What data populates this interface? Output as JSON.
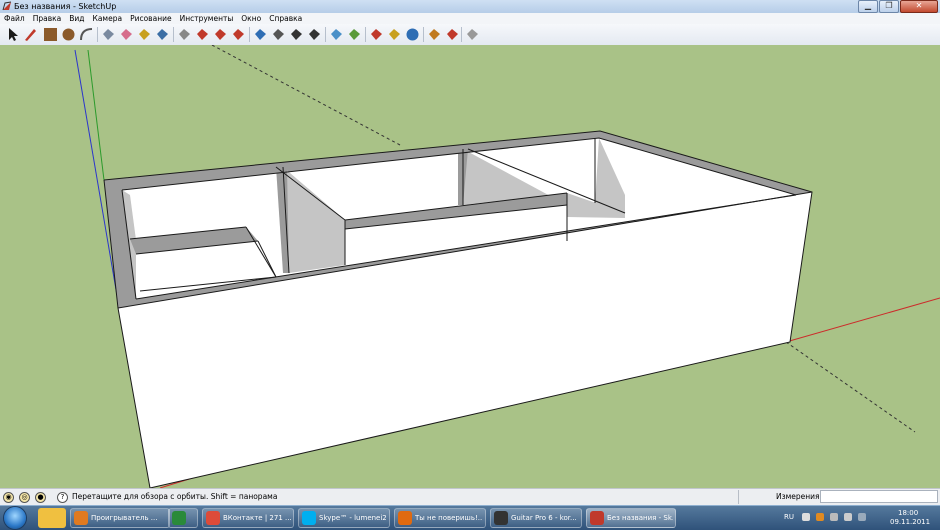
{
  "window": {
    "title": "Без названия - SketchUp",
    "minimize_glyph": "▁",
    "maximize_glyph": "❐",
    "close_glyph": "✕"
  },
  "menu": [
    "Файл",
    "Правка",
    "Вид",
    "Камера",
    "Рисование",
    "Инструменты",
    "Окно",
    "Справка"
  ],
  "toolbar": {
    "tools": [
      {
        "name": "select-icon",
        "color": "#1a1a1a"
      },
      {
        "name": "pencil-icon",
        "color": "#c0392b"
      },
      {
        "name": "rectangle-icon",
        "color": "#8b5a2b"
      },
      {
        "name": "circle-icon",
        "color": "#8b5a2b"
      },
      {
        "name": "arc-icon",
        "color": "#555555"
      },
      {
        "name": "make-component-icon",
        "color": "#7a8aa0"
      },
      {
        "name": "eraser-icon",
        "color": "#d66d8c"
      },
      {
        "name": "tape-measure-icon",
        "color": "#c8a020"
      },
      {
        "name": "paint-bucket-icon",
        "color": "#3b6ea5"
      },
      {
        "name": "push-pull-icon",
        "color": "#888888"
      },
      {
        "name": "move-icon",
        "color": "#c0392b"
      },
      {
        "name": "rotate-icon",
        "color": "#c0392b"
      },
      {
        "name": "offset-icon",
        "color": "#c0392b"
      },
      {
        "name": "orbit-icon",
        "color": "#2e6db4"
      },
      {
        "name": "pan-icon",
        "color": "#555555"
      },
      {
        "name": "zoom-icon",
        "color": "#333333"
      },
      {
        "name": "zoom-extents-icon",
        "color": "#333333"
      },
      {
        "name": "add-location-icon",
        "color": "#4a90c8"
      },
      {
        "name": "toggle-terrain-icon",
        "color": "#5a9a3a"
      },
      {
        "name": "get-models-icon",
        "color": "#c0392b"
      },
      {
        "name": "share-model-icon",
        "color": "#c8a020"
      },
      {
        "name": "google-earth-icon",
        "color": "#2e6db4"
      },
      {
        "name": "get-photo-texture-icon",
        "color": "#c07a20"
      },
      {
        "name": "component-library-icon",
        "color": "#c0392b"
      },
      {
        "name": "extension-icon",
        "color": "#999999"
      }
    ]
  },
  "statusbar": {
    "message": "Перетащите для обзора с орбиты.  Shift = панорама",
    "measurements_label": "Измерения",
    "measurements_value": ""
  },
  "taskbar": {
    "items": [
      {
        "label": "Проигрыватель ...",
        "color": "#e07a20"
      },
      {
        "label": "",
        "color": "#2a8a3a"
      },
      {
        "label": "ВКонтакте | 271 ...",
        "color": "#dd4b39"
      },
      {
        "label": "Skype™ - lumenei2",
        "color": "#00aff0"
      },
      {
        "label": "Ты не поверишь!...",
        "color": "#e06a10"
      },
      {
        "label": "Guitar Pro 6 - kor...",
        "color": "#333333"
      },
      {
        "label": "Без названия - Sk...",
        "color": "#c0392b"
      }
    ],
    "language": "RU",
    "time": "18:00",
    "date": "09.11.2011"
  },
  "colors": {
    "sky": "#a9c287",
    "wall_face": "#ffffff",
    "wall_shade": "#c5c5c5",
    "wall_top": "#9b9b9b",
    "edge": "#1a1a1a",
    "axis_red": "#cc2b2b",
    "axis_green": "#2b9a2b",
    "axis_blue": "#2b35cc"
  }
}
